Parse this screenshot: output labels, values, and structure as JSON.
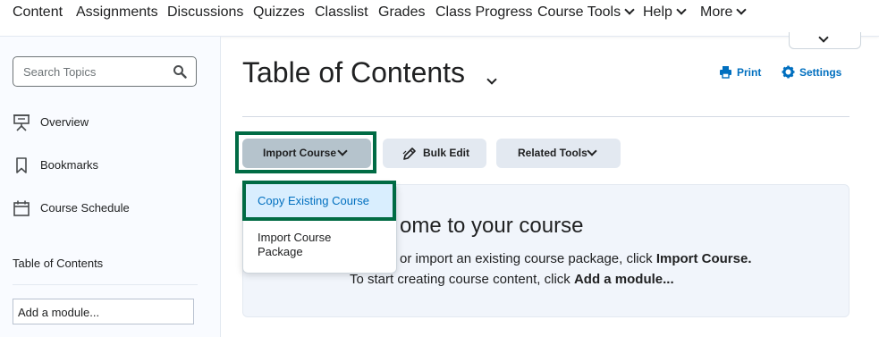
{
  "topnav": {
    "items": [
      "Content",
      "Assignments",
      "Discussions",
      "Quizzes",
      "Classlist",
      "Grades",
      "Class Progress",
      "Course Tools",
      "Help",
      "More"
    ]
  },
  "sidebar": {
    "search_placeholder": "Search Topics",
    "items": [
      {
        "label": "Overview",
        "icon": "presentation-icon"
      },
      {
        "label": "Bookmarks",
        "icon": "bookmark-icon"
      },
      {
        "label": "Course Schedule",
        "icon": "calendar-icon"
      }
    ],
    "toc_label": "Table of Contents",
    "add_module_placeholder": "Add a module..."
  },
  "main": {
    "title": "Table of Contents",
    "print_label": "Print",
    "settings_label": "Settings",
    "buttons": {
      "import_course": "Import Course",
      "bulk_edit": "Bulk Edit",
      "related_tools": "Related Tools"
    },
    "dropdown": {
      "items": [
        "Copy Existing Course",
        "Import Course Package"
      ]
    },
    "welcome": {
      "heading_visible": "ome to your course",
      "line1_visible": "or import an existing course package, click",
      "line1_bold": "Import Course.",
      "line2": "To start creating course content, click",
      "line2_bold": "Add a module..."
    }
  },
  "colors": {
    "accent_blue": "#006fbf",
    "highlight_green": "#006b44",
    "button_bg": "#e3e9f1",
    "sidebar_bg": "#f9fbff"
  }
}
